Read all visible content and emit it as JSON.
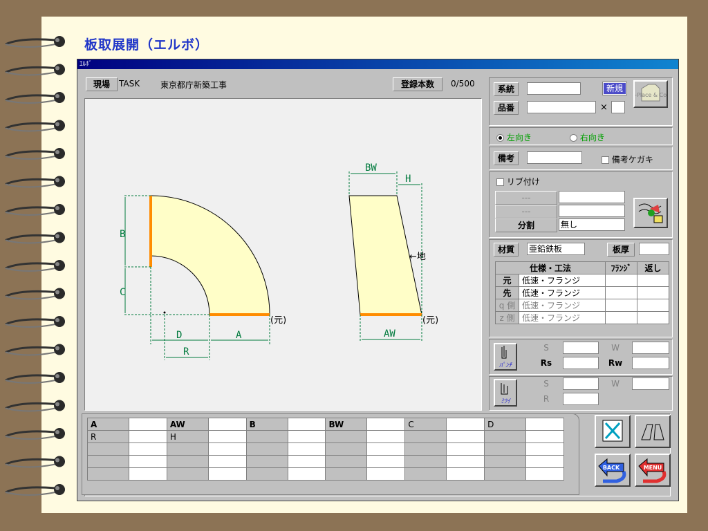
{
  "page": {
    "title": "板取展開（エルボ）"
  },
  "window": {
    "title": "ｴﾙﾎﾞ"
  },
  "header": {
    "site_label": "現場",
    "site_code": "TASK",
    "site_name": "東京都庁新築工事",
    "count_label": "登録本数",
    "count_value": "0/500"
  },
  "drawing": {
    "left": {
      "b": "B",
      "c": "C",
      "d": "D",
      "a": "A",
      "r": "R",
      "suffix": "(元)"
    },
    "right": {
      "bw": "BW",
      "h": "H",
      "aw": "AW",
      "ground": "←地",
      "suffix": "(元)"
    }
  },
  "side": {
    "keito_label": "系統",
    "keito_value": "",
    "new_button": "新規",
    "hinban_label": "品番",
    "hinban_value": "",
    "times": "×",
    "hinban_sub": "",
    "copy_icon_label": "Re-Place & Copy",
    "dir_left": "左向き",
    "dir_right": "右向き",
    "direction_selected": "left",
    "biko_label": "備考",
    "biko_value": "",
    "biko_kegaki": "備考ケガキ",
    "rib_label": "リブ付け",
    "rib_row1_label": "---",
    "rib_row2_label": "---",
    "split_label": "分割",
    "split_value": "無し",
    "material_label": "材質",
    "material_value": "亜鉛鉄板",
    "thickness_label": "板厚",
    "thickness_value": "",
    "spec_header": "仕様・工法",
    "flange_header": "ﾌﾗﾝｼﾞ",
    "kaeshi_header": "返し",
    "spec_rows": [
      {
        "label": "元",
        "value": "低速・フランジ",
        "enabled": true
      },
      {
        "label": "先",
        "value": "低速・フランジ",
        "enabled": true
      },
      {
        "label": "q 側",
        "value": "低速・フランジ",
        "enabled": false
      },
      {
        "label": "z 側",
        "value": "低速・フランジ",
        "enabled": false
      }
    ],
    "punch_label": "ﾊﾟﾝﾁ",
    "punch_s": "S",
    "punch_w": "W",
    "punch_rs": "Rs",
    "punch_rw": "Rw",
    "mitsui_label": "ﾐﾂｲ",
    "mitsui_s": "S",
    "mitsui_w": "W",
    "mitsui_r": "R"
  },
  "bottom_table": {
    "header": [
      "A",
      "",
      "AW",
      "",
      "B",
      "",
      "BW",
      "",
      "C",
      "",
      "D",
      ""
    ],
    "row2": [
      "R",
      "",
      "H",
      "",
      "",
      "",
      "",
      "",
      "",
      "",
      "",
      ""
    ]
  },
  "nav": {
    "back": "BACK",
    "menu": "MENU"
  },
  "colors": {
    "accent_orange": "#ff8c00",
    "dimension_green": "#007a3d",
    "shape_fill": "#fffec8",
    "title_blue": "#1f35c8"
  }
}
